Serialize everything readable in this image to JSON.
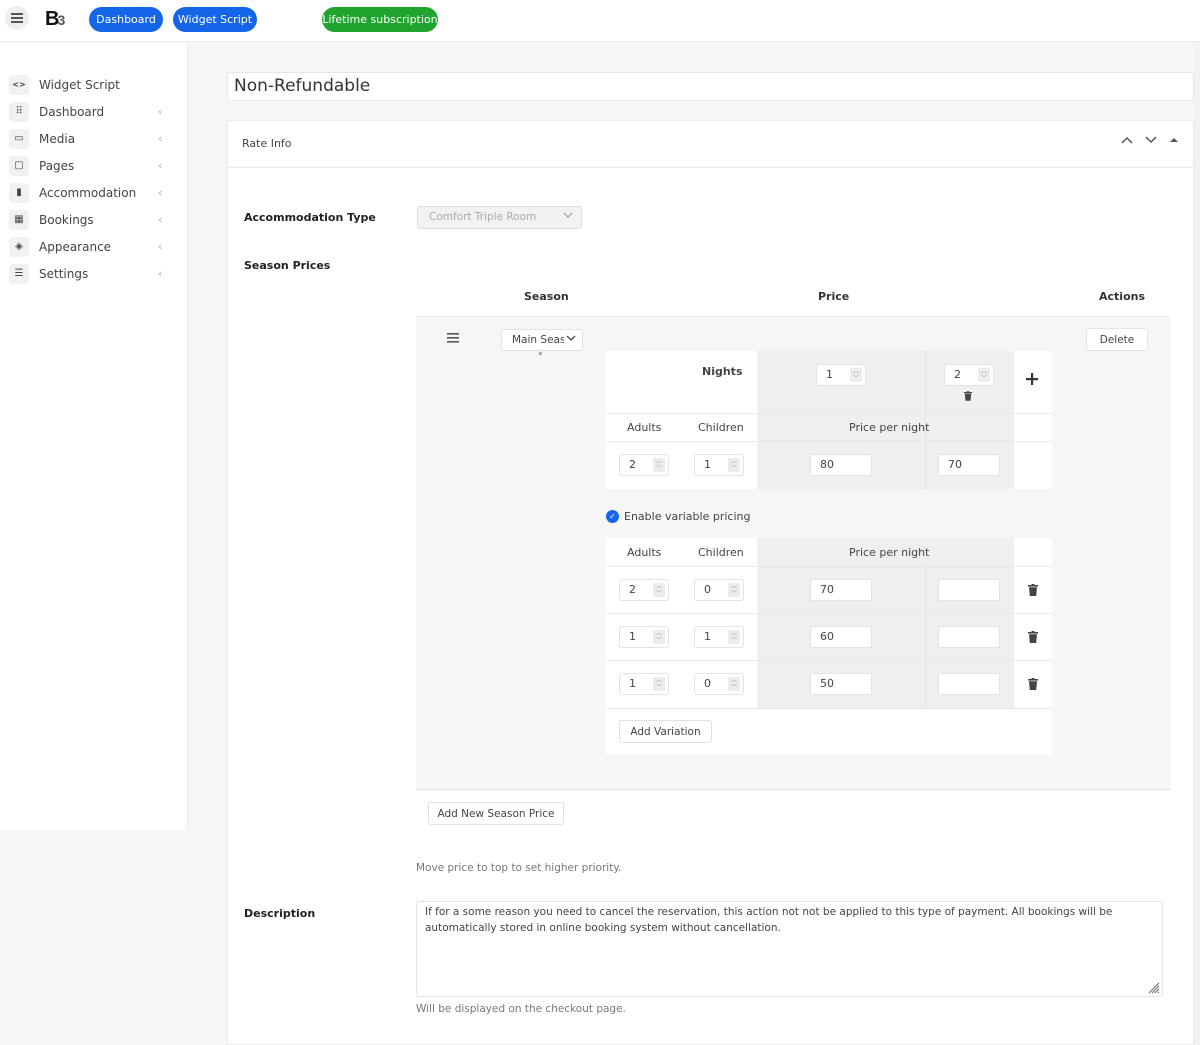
{
  "topbar": {
    "logo": "B",
    "logo_sup": "3",
    "buttons": [
      {
        "label": "Dashboard",
        "color": "#1565e8"
      },
      {
        "label": "Widget Script",
        "color": "#1565e8"
      },
      {
        "label": "Lifetime subscription",
        "color": "#1fa52e"
      }
    ]
  },
  "sidebar": {
    "items": [
      {
        "label": "Widget Script",
        "icon": "code-icon",
        "glyph": "<>",
        "has_chevron": false
      },
      {
        "label": "Dashboard",
        "icon": "grid-icon",
        "glyph": "⠿",
        "has_chevron": true
      },
      {
        "label": "Media",
        "icon": "image-icon",
        "glyph": "▭",
        "has_chevron": true
      },
      {
        "label": "Pages",
        "icon": "pages-icon",
        "glyph": "▢",
        "has_chevron": true
      },
      {
        "label": "Accommodation",
        "icon": "building-icon",
        "glyph": "▮",
        "has_chevron": true
      },
      {
        "label": "Bookings",
        "icon": "calendar-icon",
        "glyph": "▦",
        "has_chevron": true
      },
      {
        "label": "Appearance",
        "icon": "paint-bucket-icon",
        "glyph": "◈",
        "has_chevron": true
      },
      {
        "label": "Settings",
        "icon": "sliders-icon",
        "glyph": "☰",
        "has_chevron": true
      }
    ],
    "chevron": "‹"
  },
  "rate": {
    "title": "Non-Refundable",
    "panel_title": "Rate Info",
    "panel_controls": [
      "^",
      "v",
      "▲"
    ],
    "accommodation_type_label": "Accommodation Type",
    "accommodation_type_value": "Comfort Triple Room",
    "season_prices_label": "Season Prices",
    "columns": {
      "season": "Season",
      "price": "Price",
      "actions": "Actions"
    },
    "season_row": {
      "season_value": "Main Season",
      "season_display": "Main Seas",
      "required_mark": "*",
      "delete_label": "Delete",
      "nights_label": "Nights",
      "nights": [
        "1",
        "2"
      ],
      "adults_label": "Adults",
      "children_label": "Children",
      "price_per_night_label": "Price per night",
      "base": {
        "adults": "2",
        "children": "1",
        "prices": [
          "80",
          "70"
        ]
      },
      "enable_variable_pricing_label": "Enable variable pricing",
      "enable_variable_pricing_checked": true,
      "variations": [
        {
          "adults": "2",
          "children": "0",
          "prices": [
            "70",
            ""
          ]
        },
        {
          "adults": "1",
          "children": "1",
          "prices": [
            "60",
            ""
          ]
        },
        {
          "adults": "1",
          "children": "0",
          "prices": [
            "50",
            ""
          ]
        }
      ],
      "add_variation_label": "Add Variation"
    },
    "add_season_label": "Add New Season Price",
    "priority_help": "Move price to top to set higher priority.",
    "description_label": "Description",
    "description_value": "If for a some reason you need to cancel the reservation, this action not not be applied to this type of payment. All bookings will be automatically stored in online booking system without cancellation.",
    "description_help": "Will be displayed on the checkout page."
  },
  "colors": {
    "primary": "#1565e8",
    "success": "#1fa52e"
  }
}
